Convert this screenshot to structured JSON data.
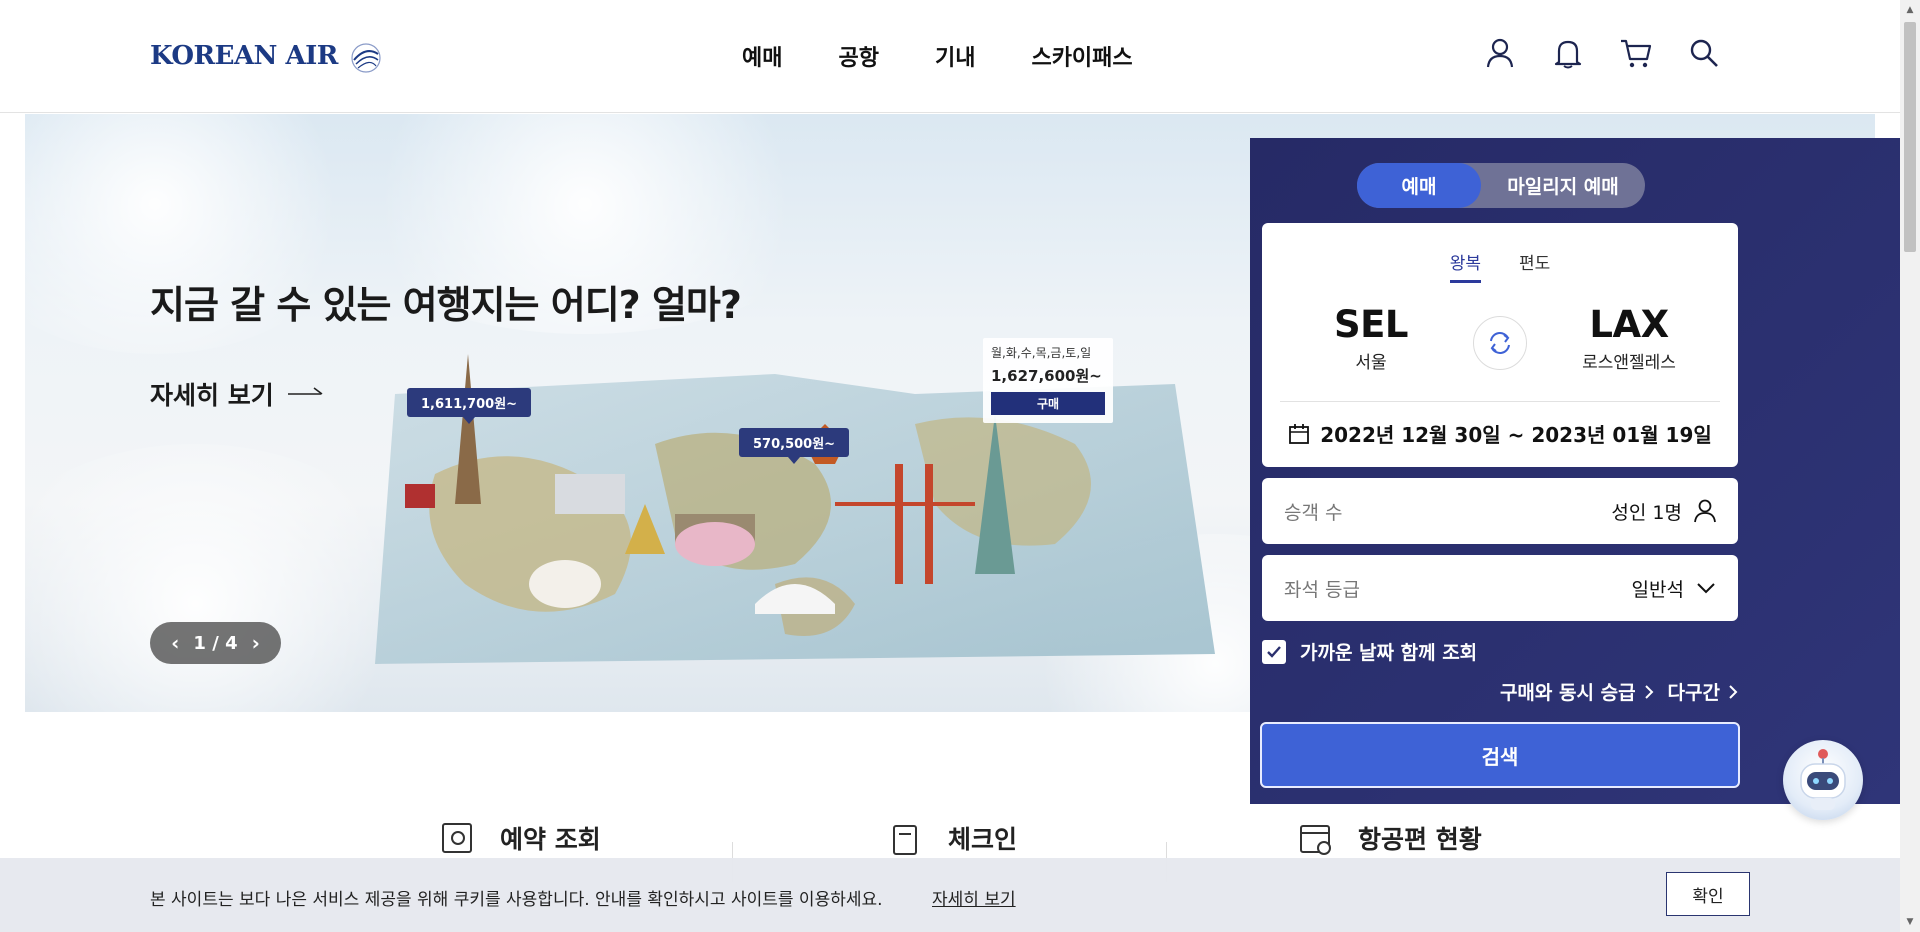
{
  "header": {
    "logo_text": "KOREAN AIR",
    "nav": [
      "예매",
      "공항",
      "기내",
      "스카이패스"
    ],
    "icons": [
      "user-icon",
      "bell-icon",
      "cart-icon",
      "search-icon"
    ]
  },
  "hero": {
    "title": "지금 갈 수 있는 여행지는 어디? 얼마?",
    "more_label": "자세히 보기",
    "price_tags": [
      "1,611,700원~",
      "570,500원~"
    ],
    "deal": {
      "days": "월,화,수,목,금,토,일",
      "price": "1,627,600원~",
      "buy_label": "구매"
    },
    "pager": {
      "current": "1",
      "separator": "/",
      "total": "4"
    }
  },
  "booking": {
    "modes": [
      "예매",
      "마일리지 예매"
    ],
    "active_mode": "예매",
    "trip_types": [
      "왕복",
      "편도"
    ],
    "active_trip_type": "왕복",
    "origin": {
      "code": "SEL",
      "name": "서울"
    },
    "destination": {
      "code": "LAX",
      "name": "로스앤젤레스"
    },
    "dates": "2022년 12월 30일 ~ 2023년 01월 19일",
    "passengers": {
      "label": "승객 수",
      "value": "성인 1명"
    },
    "cabin": {
      "label": "좌석 등급",
      "value": "일반석"
    },
    "nearby_dates": {
      "label": "가까운 날짜 함께 조회",
      "checked": true
    },
    "links": [
      "구매와 동시 승급",
      "다구간"
    ],
    "search_label": "검색"
  },
  "quick_menu": [
    {
      "label": "예약 조회",
      "icon": "reservation-icon"
    },
    {
      "label": "체크인",
      "icon": "checkin-icon"
    },
    {
      "label": "항공편 현황",
      "icon": "flight-status-icon"
    }
  ],
  "cookie": {
    "text": "본 사이트는 보다 나은 서비스 제공을 위해 쿠키를 사용합니다. 안내를 확인하시고 사이트를 이용하세요.",
    "more_label": "자세히 보기",
    "confirm_label": "확인"
  },
  "colors": {
    "brand_navy": "#1c3a84",
    "booking_panel": "#2a2f6e",
    "accent_blue": "#3e62d6",
    "price_tag": "#2c3a7c"
  }
}
